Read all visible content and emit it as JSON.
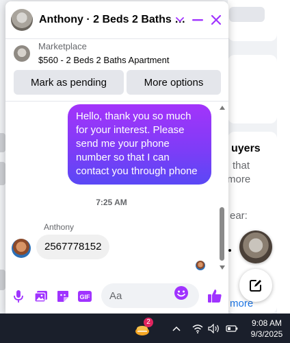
{
  "background": {
    "heading_fragment": "uyers",
    "line_that": "that",
    "line_more": "more",
    "line_ear": "ear:",
    "line_more2": "more"
  },
  "chat": {
    "title": "Anthony · 2 Beds 2 Baths …",
    "listing": {
      "label": "Marketplace",
      "title": "$560 - 2 Beds 2 Baths Apartment"
    },
    "buttons": {
      "mark_pending": "Mark as pending",
      "more_options": "More options"
    },
    "messages": [
      {
        "direction": "outgoing",
        "text": "Hello, thank you so much for your interest. Please send me your phone number so that I can contact you through phone"
      },
      {
        "direction": "incoming",
        "sender": "Anthony",
        "text": "2567778152"
      }
    ],
    "timestamp": "7:25 AM",
    "composer": {
      "placeholder": "Aa",
      "gif_label": "GIF"
    },
    "accent_color": "#a033ff"
  },
  "taskbar": {
    "badge_count": "2",
    "time": "9:08 AM",
    "date": "9/3/2025"
  }
}
